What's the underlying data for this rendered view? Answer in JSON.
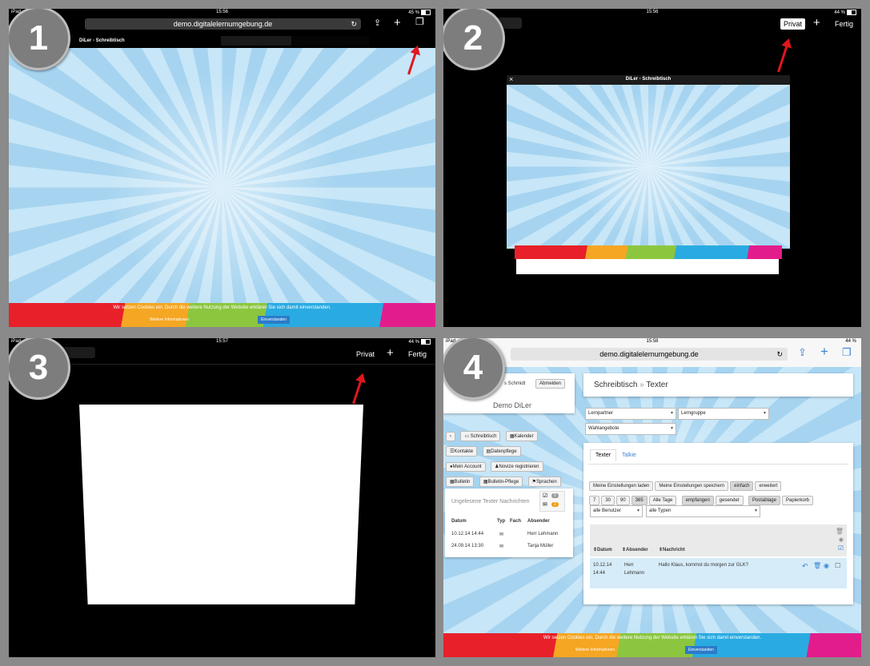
{
  "steps": [
    "1",
    "2",
    "3",
    "4"
  ],
  "panel1": {
    "status_left": "iPad",
    "time": "15:56",
    "battery": "45 %",
    "url": "demo.digitalelernumgebung.de",
    "tab_title": "DiLer - Schreibtisch",
    "cookie_text": "Wir setzen Cookies ein. Durch die weitere Nutzung der Website erklären Sie sich damit einverstanden.",
    "more_info": "Weitere Informationen",
    "agree": "Einverstanden"
  },
  "panel2": {
    "time": "15:56",
    "battery": "44 %",
    "privat": "Privat",
    "fertig": "Fertig",
    "tab_title": "DiLer - Schreibtisch"
  },
  "panel3": {
    "status_left": "iPad",
    "time": "15:57",
    "battery": "44 %",
    "privat": "Privat",
    "fertig": "Fertig"
  },
  "panel4": {
    "status_left": "iPad",
    "time": "15:58",
    "battery": "44 %",
    "url": "demo.digitalelernumgebung.de",
    "user_name": "s Schmidt",
    "logout": "Abmelden",
    "site_name": "Demo DiLer",
    "nav": [
      "Schreibtisch",
      "Kalender",
      "Kontakte",
      "Datenpflege",
      "Mein Account",
      "Novize registrieren",
      "Bulletin",
      "Bulletin-Pflege",
      "Sprachen"
    ],
    "unread_title": "Ungelesene Texter Nachrichten",
    "unread_counts": [
      "0",
      "2"
    ],
    "unread_headers": [
      "Datum",
      "Typ",
      "Fach",
      "Absender"
    ],
    "unread_rows": [
      {
        "date": "10.12.14 14:44",
        "sender": "Herr Lehmann"
      },
      {
        "date": "24.09.14 13:30",
        "sender": "Tanja Müller"
      }
    ],
    "crumb_home": "Schreibtisch",
    "crumb_sep": "»",
    "crumb_page": "Texter",
    "filters": [
      "Lernpartner",
      "Lerngruppe",
      "Wahlangebote"
    ],
    "tabs": [
      "Texter",
      "Talkie"
    ],
    "settings_buttons": [
      "Meine Einstellungen laden",
      "Meine Einstellungen speichern",
      "einfach",
      "erweitert"
    ],
    "day_buttons": [
      "7",
      "30",
      "90",
      "365",
      "Alle Tage"
    ],
    "box_buttons": [
      "empfangen",
      "gesendet",
      "Postablage",
      "Papierkorb"
    ],
    "user_select": "alle Benutzer",
    "type_select": "alle Typen",
    "msg_headers": [
      "Datum",
      "Absender",
      "Nachricht"
    ],
    "message": {
      "date1": "10.12.14",
      "date2": "14:44",
      "sender1": "Herr",
      "sender2": "Lehmann",
      "text": "Hallo Klaus, kommst du morgen zur GLK?"
    },
    "cookie_text": "Wir setzen Cookies ein. Durch die weitere Nutzung der Website erklären Sie sich damit einverstanden.",
    "more_info": "Weitere Informationen",
    "agree": "Einverstanden"
  },
  "colors": {
    "arrow": "#e0161f",
    "link_blue": "#3b82d8",
    "badge": "#7d7d7d"
  }
}
